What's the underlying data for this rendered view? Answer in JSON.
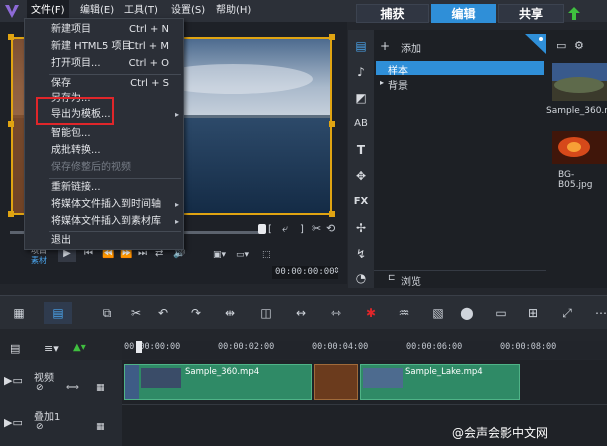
{
  "menubar": {
    "items": [
      "文件(F)",
      "编辑(E)",
      "工具(T)",
      "设置(S)",
      "帮助(H)"
    ]
  },
  "mode_tabs": [
    "捕获",
    "编辑",
    "共享"
  ],
  "file_menu": {
    "items": [
      {
        "label": "新建项目",
        "shortcut": "Ctrl + N"
      },
      {
        "label": "新建 HTML5 项目",
        "shortcut": "Ctrl + M"
      },
      {
        "label": "打开项目...",
        "shortcut": "Ctrl + O"
      },
      {
        "label": "保存",
        "shortcut": "Ctrl + S"
      },
      {
        "label": "另存为..."
      },
      {
        "label": "导出为模板..."
      },
      {
        "label": "智能包..."
      },
      {
        "label": "成批转换..."
      },
      {
        "label": "保存修整后的视频"
      },
      {
        "label": "重新链接..."
      },
      {
        "label": "将媒体文件插入到时间轴"
      },
      {
        "label": "将媒体文件插入到素材库"
      },
      {
        "label": "退出"
      }
    ]
  },
  "player": {
    "project_label": "项目",
    "clip_label": "素材",
    "timecode_main": "00:00:00:00",
    "bracket_in": "[",
    "bracket_out": "]"
  },
  "library": {
    "add_label": "添加",
    "folder_sample": "样本",
    "folder_background": "背景",
    "browse_label": "浏览",
    "thumb1_label": "Sample_360.mp",
    "thumb2_label": "BG-B05.jpg"
  },
  "timeline": {
    "ticks": [
      "00:00:00:00",
      "00:00:02:00",
      "00:00:04:00",
      "00:00:06:00",
      "00:00:08:00"
    ],
    "video_track_label": "视频",
    "overlay_track_label": "叠加1",
    "clip1_title": "Sample_360.mp4",
    "clip2_title": "Sample_Lake.mp4"
  },
  "watermark": "@会声会影中文网"
}
